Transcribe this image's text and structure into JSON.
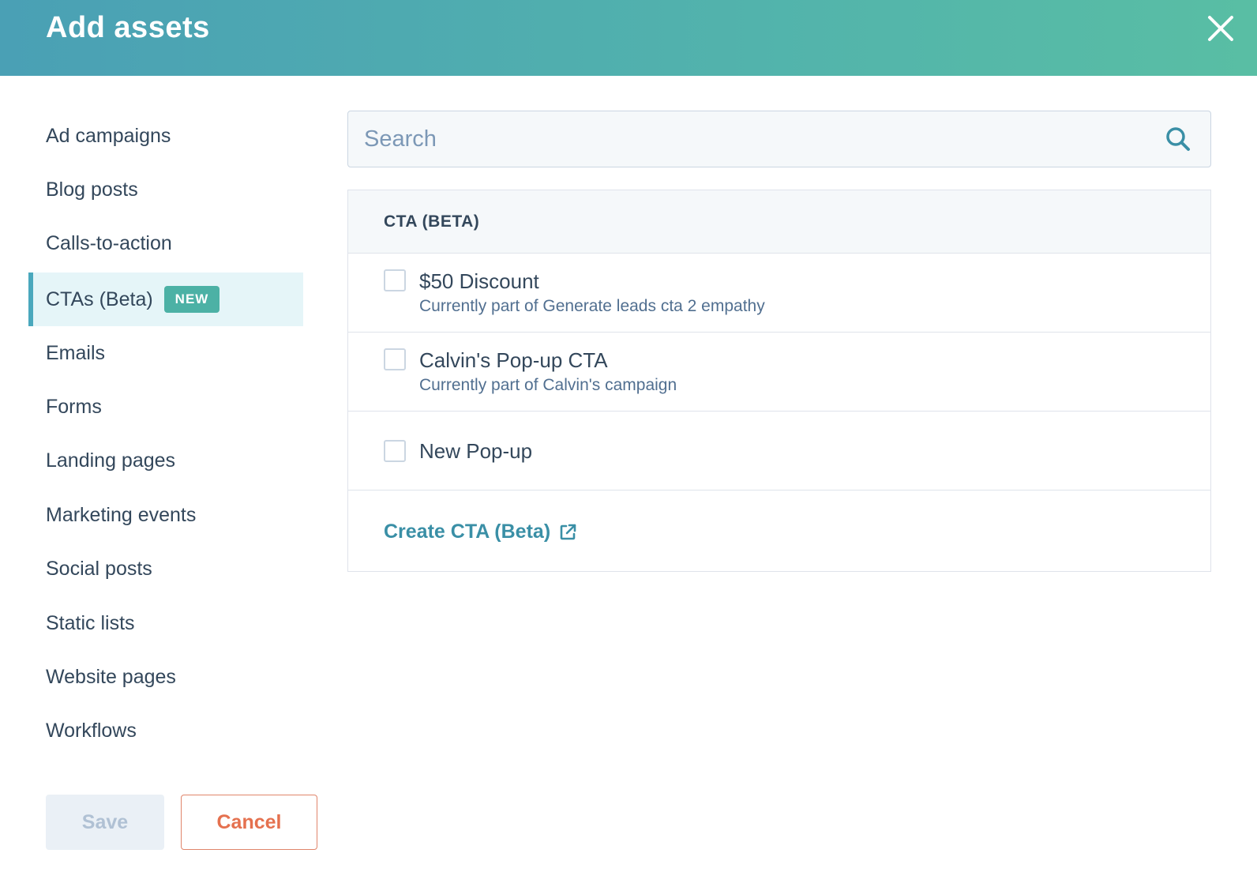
{
  "header": {
    "title": "Add assets",
    "close_icon": "close-icon"
  },
  "sidebar": {
    "items": [
      {
        "label": "Ad campaigns"
      },
      {
        "label": "Blog posts"
      },
      {
        "label": "Calls-to-action"
      },
      {
        "label": "CTAs (Beta)",
        "badge": "NEW",
        "active": true
      },
      {
        "label": "Emails"
      },
      {
        "label": "Forms"
      },
      {
        "label": "Landing pages"
      },
      {
        "label": "Marketing events"
      },
      {
        "label": "Social posts"
      },
      {
        "label": "Static lists"
      },
      {
        "label": "Website pages"
      },
      {
        "label": "Workflows"
      }
    ]
  },
  "search": {
    "placeholder": "Search",
    "value": "",
    "icon": "search-icon"
  },
  "list": {
    "header": "CTA (BETA)",
    "items": [
      {
        "title": "$50 Discount",
        "subtitle": "Currently part of Generate leads cta 2 empathy",
        "checked": false
      },
      {
        "title": "Calvin's Pop-up CTA",
        "subtitle": "Currently part of Calvin's campaign",
        "checked": false
      },
      {
        "title": "New Pop-up",
        "subtitle": "",
        "checked": false
      }
    ],
    "create_link": "Create CTA (Beta)",
    "create_link_icon": "external-link-icon"
  },
  "footer": {
    "save_label": "Save",
    "cancel_label": "Cancel"
  },
  "colors": {
    "header_gradient_start": "#4aa0b5",
    "header_gradient_end": "#59bea4",
    "accent": "#4aa8bd",
    "badge": "#4cb1a5",
    "link": "#3a8fa6",
    "cancel": "#e5714f"
  }
}
